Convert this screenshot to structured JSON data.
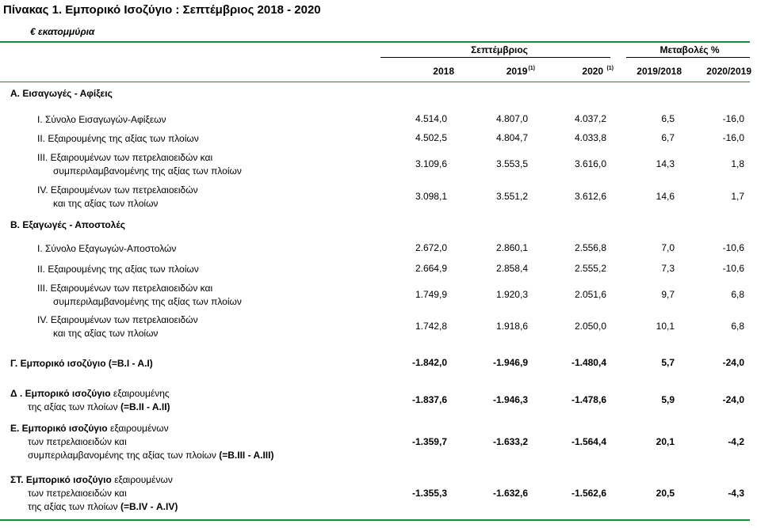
{
  "title": "Πίνακας 1. Εμπορικό Ισοζύγιο :  Σεπτέμβριος 2018  - 2020",
  "unit": "€ εκατομμύρια",
  "header": {
    "group_left": "Σεπτέμβριος",
    "group_right": "Μεταβολές %",
    "cols": [
      "2018",
      "2019",
      "2020",
      "2019/2018",
      "2020/2019"
    ],
    "note_2019": "(1)",
    "note_2020": "(1)"
  },
  "sections": {
    "A": "Α. Εισαγωγές - Αφίξεις",
    "B": "Β. Εξαγωγές - Αποστολές"
  },
  "rows": [
    {
      "l1": "Ι.  Σύνολο Εισαγωγών-Αφίξεων",
      "v": [
        "4.514,0",
        "4.807,0",
        "4.037,2",
        "6,5",
        "-16,0"
      ]
    },
    {
      "l1": "ΙΙ.  Εξαιρουμένης  της αξίας των πλοίων",
      "v": [
        "4.502,5",
        "4.804,7",
        "4.033,8",
        "6,7",
        "-16,0"
      ]
    },
    {
      "l1": "ΙΙΙ.  Εξαιρουμένων των πετρελαιοειδών και",
      "l2": "συμπεριλαμβανομένης της αξίας των πλοίων",
      "v": [
        "3.109,6",
        "3.553,5",
        "3.616,0",
        "14,3",
        "1,8"
      ]
    },
    {
      "l1": "ΙV.  Εξαιρουμένων των πετρελαιοειδών",
      "l2": "και της αξίας των πλοίων",
      "v": [
        "3.098,1",
        "3.551,2",
        "3.612,6",
        "14,6",
        "1,7"
      ]
    },
    {
      "l1": "Ι.  Σύνολο Εξαγωγών-Αποστολών",
      "v": [
        "2.672,0",
        "2.860,1",
        "2.556,8",
        "7,0",
        "-10,6"
      ]
    },
    {
      "l1": "ΙΙ.  Εξαιρουμένης  της αξίας των πλοίων",
      "v": [
        "2.664,9",
        "2.858,4",
        "2.555,2",
        "7,3",
        "-10,6"
      ]
    },
    {
      "l1": "ΙΙΙ.  Εξαιρουμένων των πετρελαιοειδών και",
      "l2": "συμπεριλαμβανομένης της αξίας των πλοίων",
      "v": [
        "1.749,9",
        "1.920,3",
        "2.051,6",
        "9,7",
        "6,8"
      ]
    },
    {
      "l1": "ΙV.  Εξαιρουμένων των πετρελαιοειδών",
      "l2": "και της αξίας των πλοίων",
      "v": [
        "1.742,8",
        "1.918,6",
        "2.050,0",
        "10,1",
        "6,8"
      ]
    }
  ],
  "balances": [
    {
      "bold1": "Γ. Εμπορικό ισοζύγιο (=Β.Ι - Α.Ι)",
      "v": [
        "-1.842,0",
        "-1.946,9",
        "-1.480,4",
        "5,7",
        "-24,0"
      ]
    },
    {
      "bold1": "Δ . Εμπορικό ισοζύγιο",
      "reg1": " εξαιρουμένης",
      "reg2": "της αξίας των πλοίων",
      "bold2": " (=Β.ΙΙ - Α.ΙΙ)",
      "v": [
        "-1.837,6",
        "-1.946,3",
        "-1.478,6",
        "5,9",
        "-24,0"
      ]
    },
    {
      "bold1": "Ε. Εμπορικό ισοζύγιο",
      "reg1": " εξαιρουμένων",
      "reg2": "των πετρελαιοειδών και",
      "reg3": "συμπεριλαμβανομένης της αξίας των πλοίων",
      "bold3": " (=Β.ΙΙΙ - Α.ΙΙΙ)",
      "v": [
        "-1.359,7",
        "-1.633,2",
        "-1.564,4",
        "20,1",
        "-4,2"
      ]
    },
    {
      "bold1": "ΣΤ. Εμπορικό ισοζύγιο",
      "reg1": " εξαιρουμένων",
      "reg2": "των πετρελαιοειδών και",
      "reg3": "της αξίας των πλοίων",
      "bold3": " (=Β.ΙV - Α.ΙV)",
      "v": [
        "-1.355,3",
        "-1.632,6",
        "-1.562,6",
        "20,5",
        "-4,3"
      ]
    }
  ]
}
